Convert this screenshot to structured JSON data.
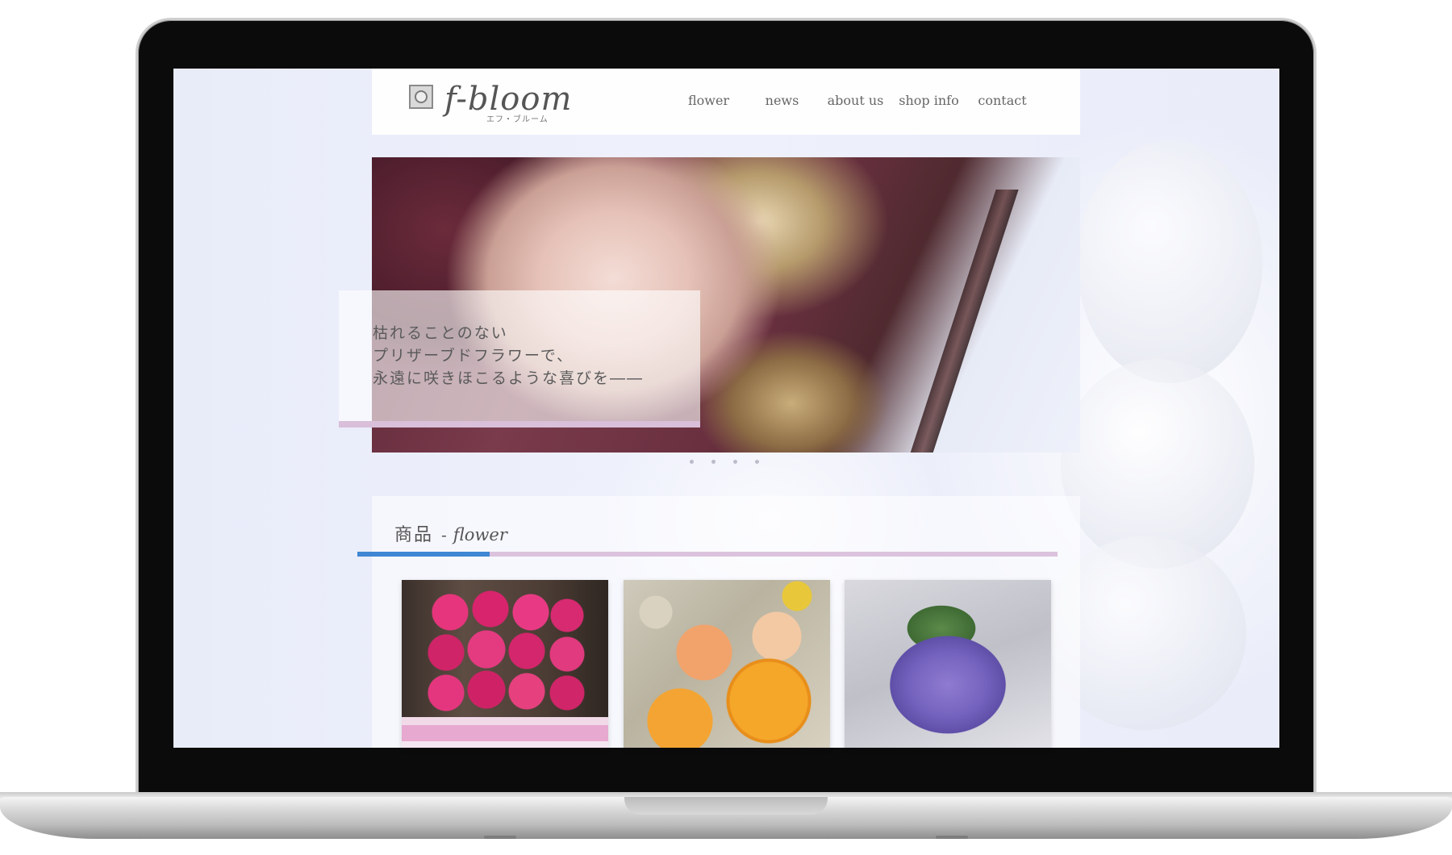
{
  "site": {
    "logo_text": "f-bloom",
    "logo_subtext": "エフ・ブルーム",
    "nav": [
      {
        "label": "flower"
      },
      {
        "label": "news"
      },
      {
        "label": "about us"
      },
      {
        "label": "shop info"
      },
      {
        "label": "contact"
      }
    ]
  },
  "hero": {
    "caption_lines": [
      "枯れることのない",
      "プリザーブドフラワーで、",
      "永遠に咲きほこるような喜びを――"
    ],
    "slide_count": 4
  },
  "products": {
    "title_jp": "商品",
    "title_dash": "-",
    "title_en": "flower",
    "items": [
      {
        "icon": "pink-rose-box-image"
      },
      {
        "icon": "orange-rose-arrangement-image"
      },
      {
        "icon": "purple-bouquet-image"
      }
    ]
  },
  "colors": {
    "accent_blue": "#3f86d3",
    "accent_lavender": "#dcc3dd",
    "text": "#555555"
  }
}
